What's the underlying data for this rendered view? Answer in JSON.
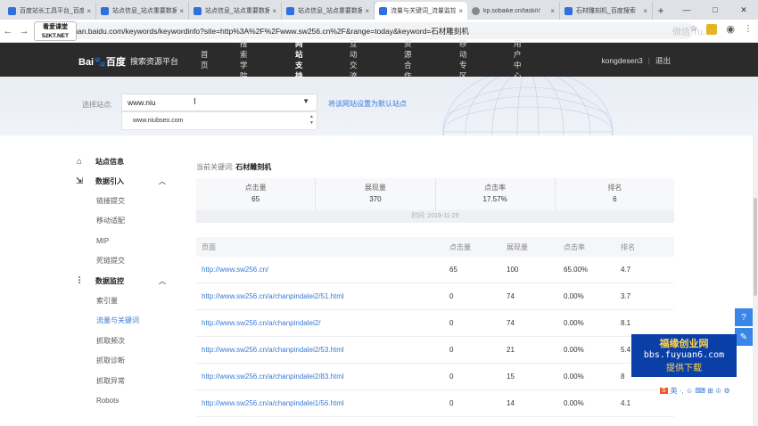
{
  "browser": {
    "tabs": [
      {
        "title": "百度站长工具平台_百度...",
        "active": false
      },
      {
        "title": "站点信息_站点重要数据...",
        "active": false
      },
      {
        "title": "站点信息_站点重要数据...",
        "active": false
      },
      {
        "title": "站点信息_站点重要数据...",
        "active": false
      },
      {
        "title": "流量与关键词_流量监控...",
        "active": true
      },
      {
        "title": "kp.sobaike.cn/task/r/",
        "active": false
      },
      {
        "title": "石材雕刻机_百度搜索",
        "active": false
      }
    ],
    "new_tab": "+",
    "window_controls": [
      "—",
      "□",
      "✕"
    ],
    "url": "ziyuan.baidu.com/keywords/keywordinfo?site=http%3A%2F%2Fwww.sw256.cn%2F&range=today&keyword=石材雕刻机",
    "watermark_line1": "看爱课堂",
    "watermark_line2": "52KT.NET",
    "ghost_text": "微信 Tu..."
  },
  "topnav": {
    "logo_text": "Bai度百度",
    "site_name": "搜索资源平台",
    "items": [
      "首页",
      "搜索学院",
      "网站支持",
      "互动交流",
      "资源合作",
      "移动专区",
      "用户中心"
    ],
    "active_index": 2,
    "username": "kongdesen3",
    "logout": "退出"
  },
  "site_select": {
    "label": "选择站点:",
    "value": "www.niu",
    "dropdown_option": "www.niubseo.com",
    "set_default": "将该网站设置为默认站点"
  },
  "sidebar": {
    "groups": [
      {
        "icon": "home-icon",
        "label": "站点信息",
        "items": []
      },
      {
        "icon": "data-import-icon",
        "label": "数据引入",
        "items": [
          "链接提交",
          "移动适配",
          "MIP",
          "死链提交"
        ]
      },
      {
        "icon": "chart-monitor-icon",
        "label": "数据监控",
        "items": [
          "索引量",
          "流量与关键词",
          "抓取频次",
          "抓取诊断",
          "抓取异常",
          "Robots"
        ]
      }
    ],
    "active_item": "流量与关键词"
  },
  "keyword": {
    "prefix": "当前关键词:",
    "value": "石材雕刻机"
  },
  "stats": [
    {
      "label": "点击量",
      "value": "65"
    },
    {
      "label": "展现量",
      "value": "370"
    },
    {
      "label": "点击率",
      "value": "17.57%"
    },
    {
      "label": "排名",
      "value": "6"
    }
  ],
  "time_label": "时间: 2019-11-29",
  "table": {
    "headers": [
      "页面",
      "点击量",
      "展现量",
      "点击率",
      "排名"
    ],
    "rows": [
      [
        "http://www.sw256.cn/",
        "65",
        "100",
        "65.00%",
        "4.7"
      ],
      [
        "http://www.sw256.cn/a/chanpindalei2/51.html",
        "0",
        "74",
        "0.00%",
        "3.7"
      ],
      [
        "http://www.sw256.cn/a/chanpindalei2/",
        "0",
        "74",
        "0.00%",
        "8.1"
      ],
      [
        "http://www.sw256.cn/a/chanpindalei2/53.html",
        "0",
        "21",
        "0.00%",
        "5.4"
      ],
      [
        "http://www.sw256.cn/a/chanpindalei2/83.html",
        "0",
        "15",
        "0.00%",
        "8"
      ],
      [
        "http://www.sw256.cn/a/chanpindalei1/56.html",
        "0",
        "14",
        "0.00%",
        "4.1"
      ]
    ]
  },
  "promo": {
    "line1": "福缘创业网",
    "line2": "bbs.fuyuan6.com",
    "line3": "提供下载"
  },
  "ime": {
    "badge": "S",
    "text": "英 ·, ☺ ⌨ ⊞ ♔ ⚙"
  }
}
